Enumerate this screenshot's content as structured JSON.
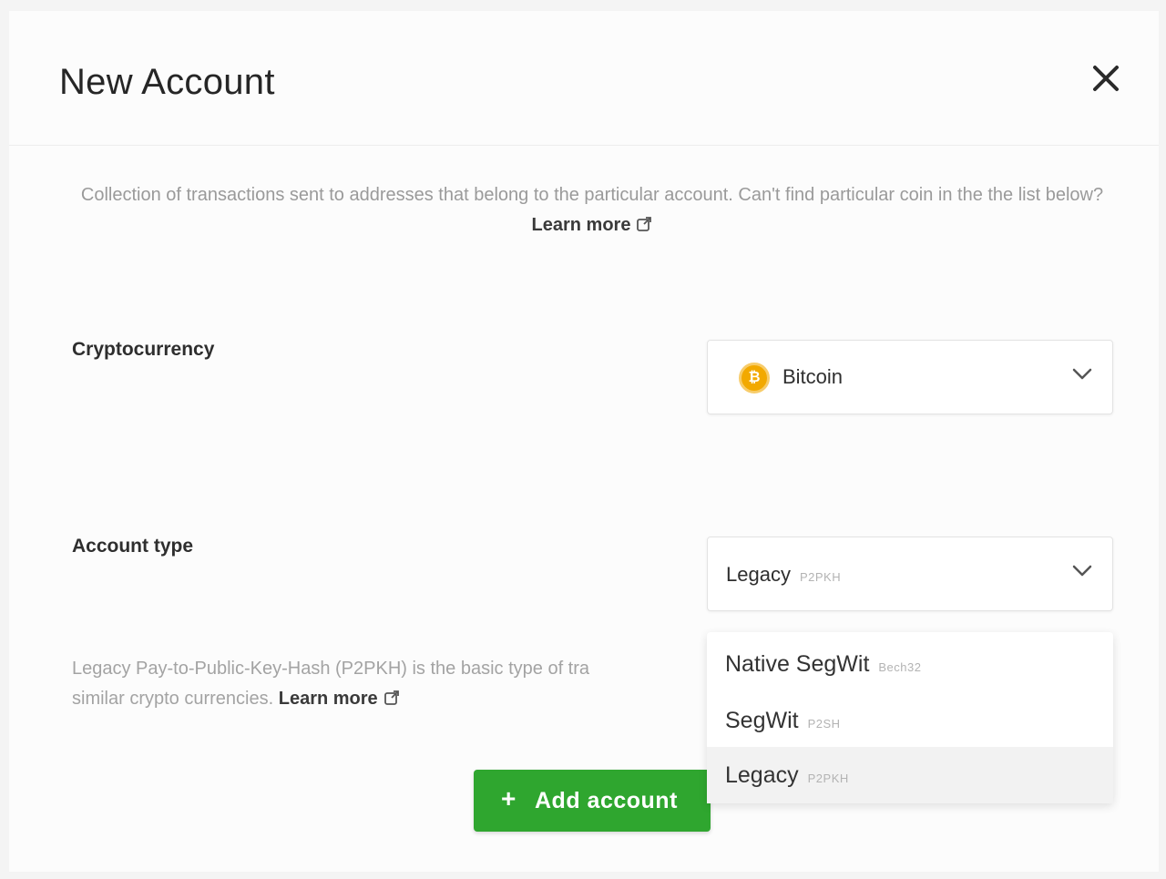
{
  "dialog": {
    "title": "New Account",
    "close_icon": "close-icon"
  },
  "description": {
    "text": "Collection of transactions sent to addresses that belong to the particular account. Can't find particular coin in the the list below?",
    "link": "Learn more"
  },
  "cryptocurrency": {
    "label": "Cryptocurrency",
    "selected": "Bitcoin",
    "icon": "bitcoin-icon",
    "icon_color": "#f2a900"
  },
  "account_type": {
    "label": "Account type",
    "selected_name": "Legacy",
    "selected_tag": "P2PKH",
    "options": [
      {
        "name": "Native SegWit",
        "tag": "Bech32"
      },
      {
        "name": "SegWit",
        "tag": "P2SH"
      },
      {
        "name": "Legacy",
        "tag": "P2PKH"
      }
    ],
    "help_line1": "Legacy Pay-to-Public-Key-Hash (P2PKH) is the basic type of tra",
    "help_line2": "similar crypto currencies.",
    "help_link": "Learn more"
  },
  "add_button": {
    "label": "Add account",
    "color": "#2fa62f"
  }
}
